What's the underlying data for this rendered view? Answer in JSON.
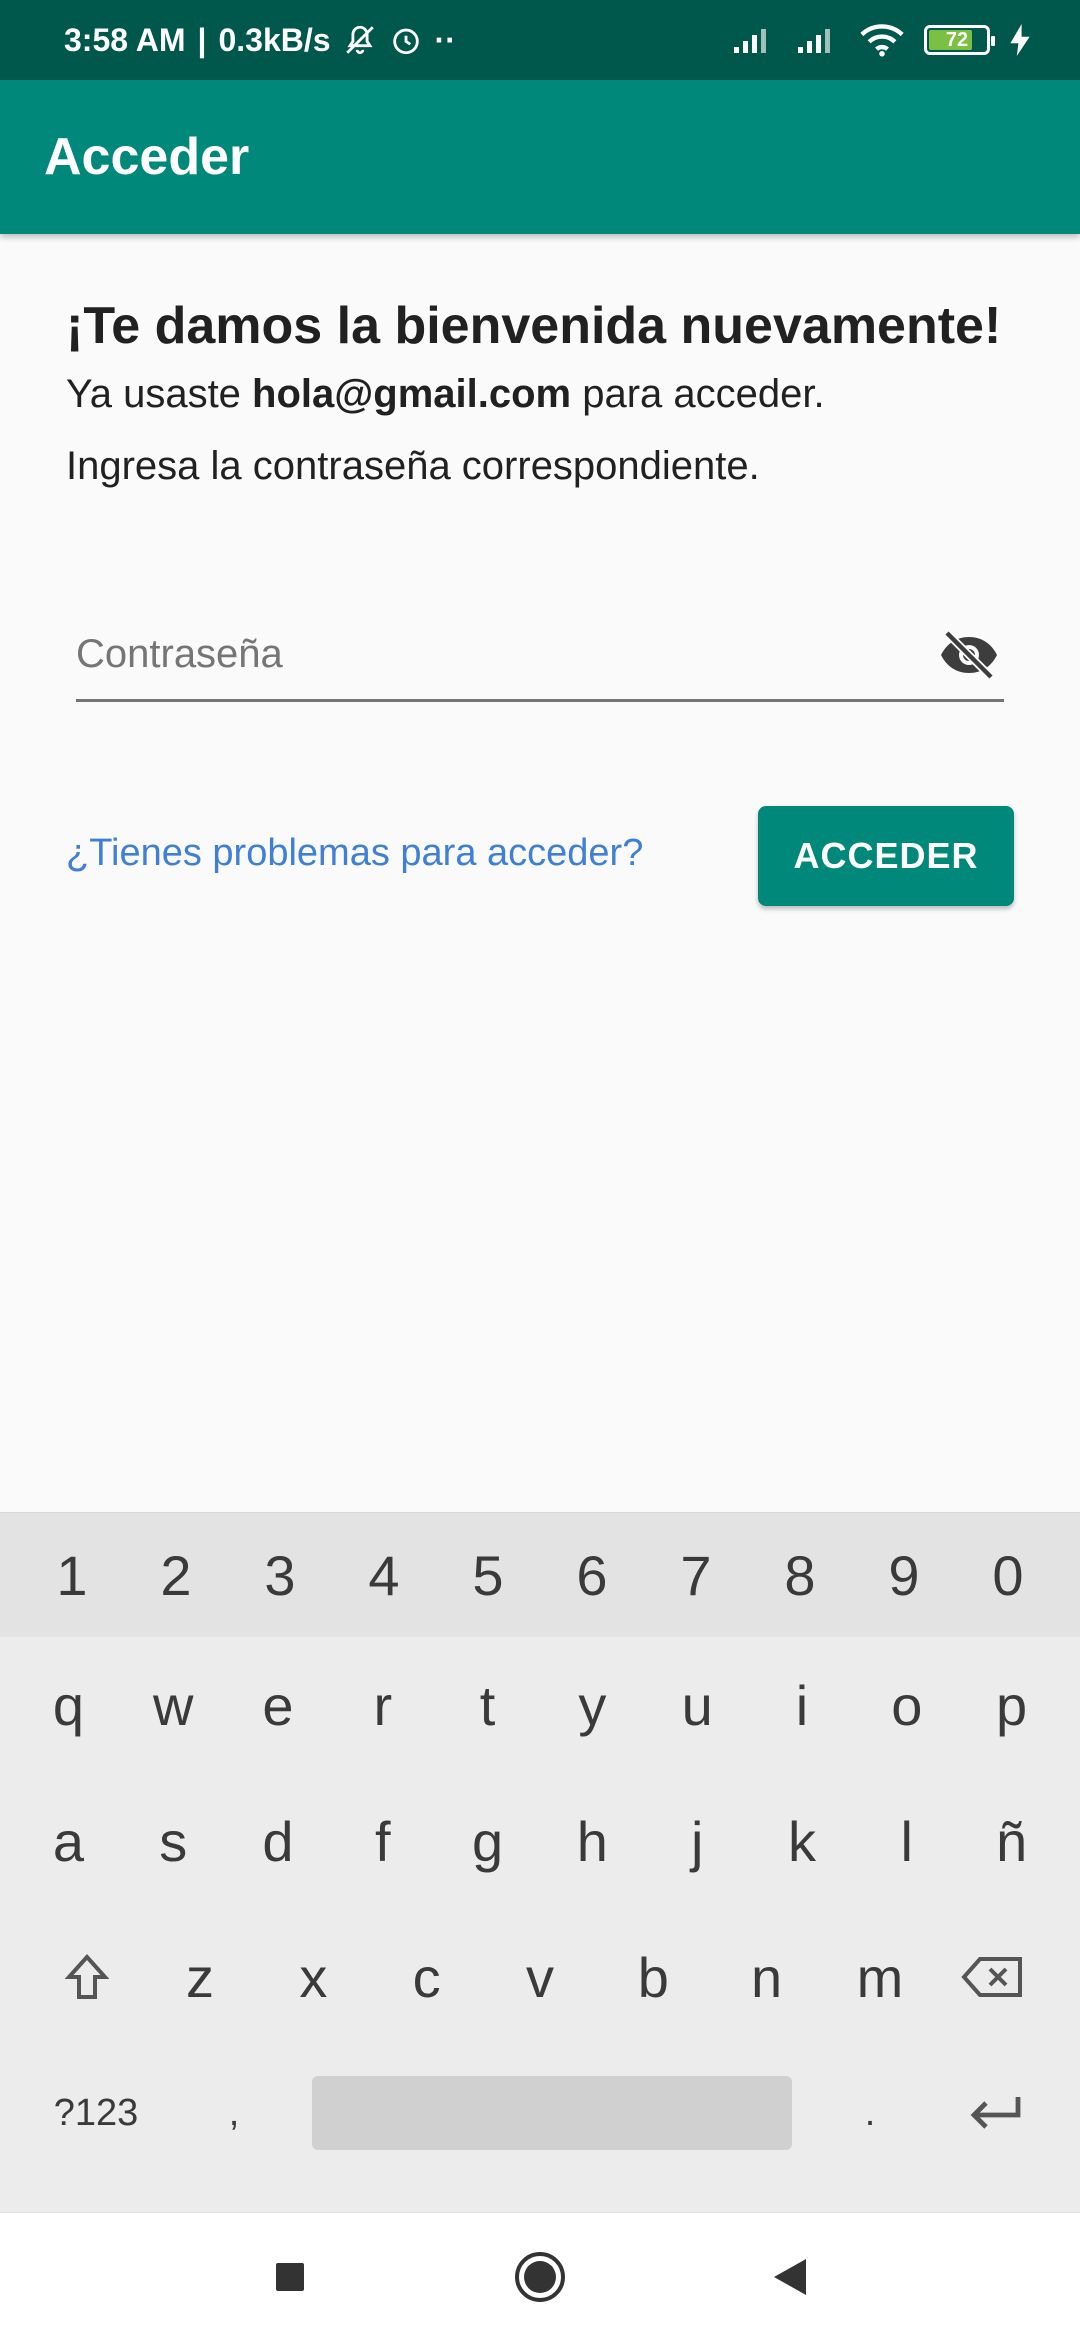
{
  "status_bar": {
    "time": "3:58 AM",
    "separator": "|",
    "speed": "0.3kB/s",
    "dots": "··",
    "battery_level": "72",
    "status_bar_color": "#00574b"
  },
  "app_bar": {
    "title": "Acceder",
    "color": "#00897b"
  },
  "content": {
    "welcome": "¡Te damos la bienvenida nuevamente!",
    "used_prefix": "Ya usaste",
    "email": "hola@gmail.com",
    "used_suffix": "para acceder.",
    "instruction": "Ingresa la contraseña correspondiente."
  },
  "password": {
    "placeholder": "Contraseña",
    "value": "",
    "toggle_icon": "visibility-off-icon"
  },
  "actions": {
    "help_link": "¿Tienes problemas para acceder?",
    "submit": "ACCEDER",
    "link_color": "#3f7fd6"
  },
  "keyboard": {
    "numbers": [
      "1",
      "2",
      "3",
      "4",
      "5",
      "6",
      "7",
      "8",
      "9",
      "0"
    ],
    "row1": [
      "q",
      "w",
      "e",
      "r",
      "t",
      "y",
      "u",
      "i",
      "o",
      "p"
    ],
    "row2": [
      "a",
      "s",
      "d",
      "f",
      "g",
      "h",
      "j",
      "k",
      "l",
      "ñ"
    ],
    "row3": [
      "z",
      "x",
      "c",
      "v",
      "b",
      "n",
      "m"
    ],
    "symbols_key": "?123",
    "comma": ",",
    "period": "."
  },
  "nav_bar": {
    "icons": [
      "recents-square-icon",
      "home-circle-icon",
      "back-triangle-icon"
    ]
  }
}
